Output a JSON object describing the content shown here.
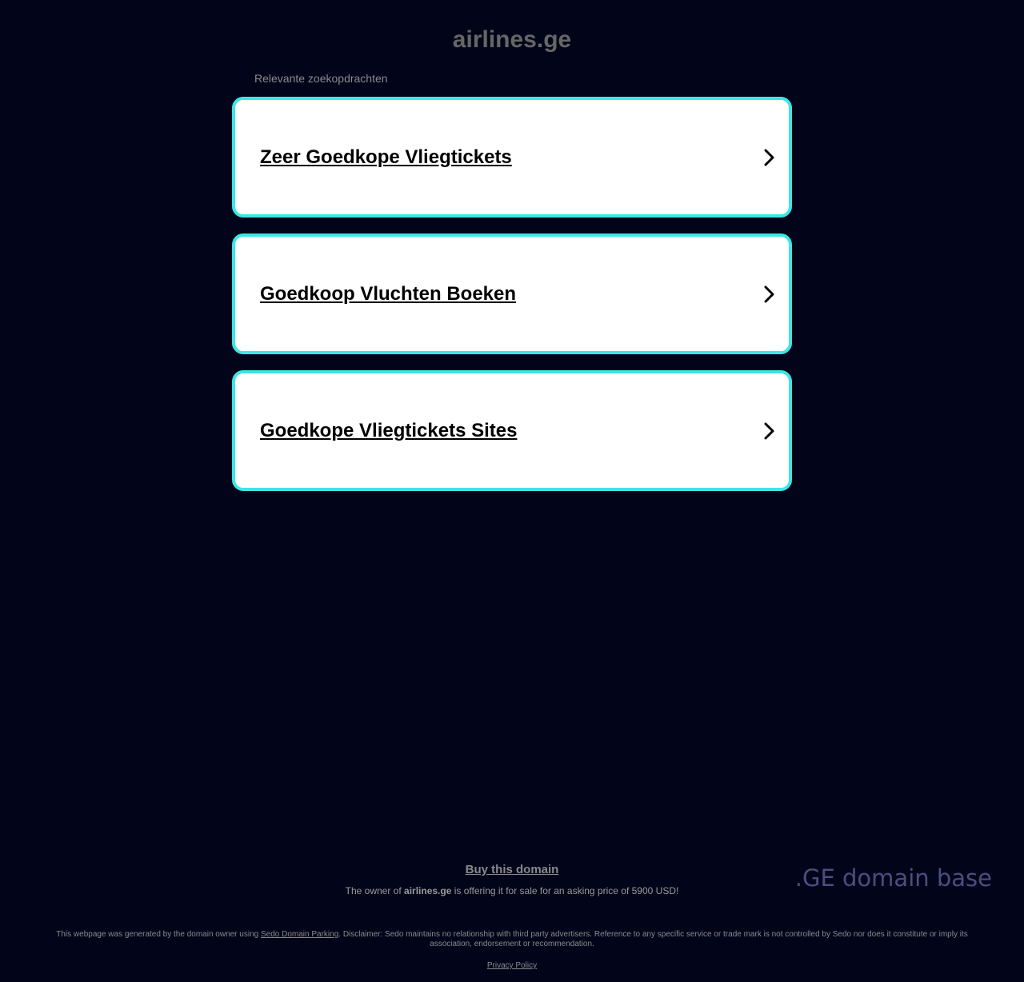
{
  "header": {
    "domain": "airlines.ge",
    "related_label": "Relevante zoekopdrachten"
  },
  "search_links": [
    {
      "label": "Zeer Goedkope Vliegtickets",
      "icon": "chevron-right-icon"
    },
    {
      "label": "Goedkoop Vluchten Boeken",
      "icon": "chevron-right-icon"
    },
    {
      "label": "Goedkope Vliegtickets Sites",
      "icon": "chevron-right-icon"
    }
  ],
  "sale": {
    "buy_label": "Buy this domain",
    "text_prefix": "The owner of ",
    "domain": "airlines.ge",
    "text_suffix": " is offering it for sale for an asking price of 5900 USD!"
  },
  "brand": {
    "logo_text": ".GE domain base"
  },
  "footer": {
    "disclaimer_prefix": "This webpage was generated by the domain owner using ",
    "sedo_link": "Sedo Domain Parking",
    "disclaimer_suffix": ". Disclaimer: Sedo maintains no relationship with third party advertisers. Reference to any specific service or trade mark is not controlled by Sedo nor does it constitute or imply its association, endorsement or recommendation.",
    "privacy_label": "Privacy Policy"
  },
  "colors": {
    "background": "#02051a",
    "card_border": "#3ce6e6",
    "card_background": "#ffffff",
    "muted_text": "#8a8a8a",
    "logo": "#4a4e7e"
  }
}
